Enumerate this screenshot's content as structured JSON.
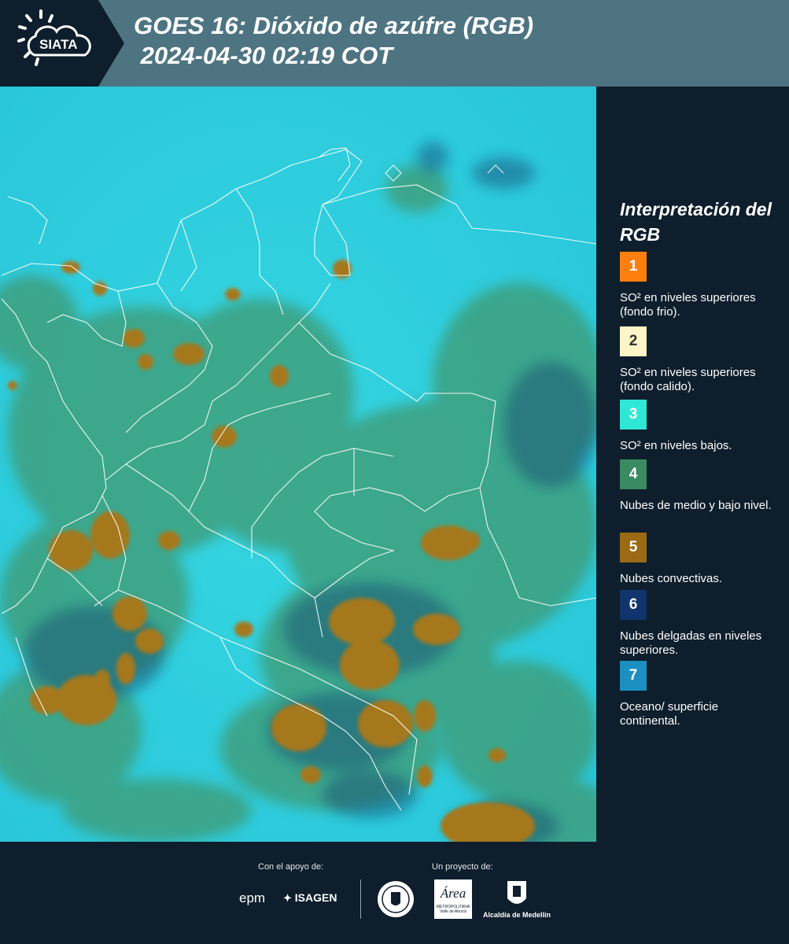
{
  "header": {
    "logo_text": "SIATA",
    "title_line1": "GOES 16: Dióxido de azúfre (RGB)",
    "title_line2": " 2024-04-30 02:19 COT"
  },
  "legend": {
    "title": "Interpretación del RGB",
    "items": [
      {
        "number": "1",
        "color": "#ff7f0e",
        "text": "SO² en niveles superiores (fondo frio)."
      },
      {
        "number": "2",
        "color": "#fdf5c6",
        "text": "SO² en niveles superiores (fondo calido)."
      },
      {
        "number": "3",
        "color": "#2ee8d5",
        "text": "SO² en niveles bajos."
      },
      {
        "number": "4",
        "color": "#3a8a62",
        "text": "Nubes de medio y bajo nivel."
      },
      {
        "number": "5",
        "color": "#9b6a14",
        "text": "Nubes convectivas."
      },
      {
        "number": "6",
        "color": "#10346b",
        "text": "Nubes delgadas en niveles superiores."
      },
      {
        "number": "7",
        "color": "#1a8fc0",
        "text": "Oceano/ superficie continental."
      }
    ]
  },
  "footer": {
    "support_label": "Con el apoyo de:",
    "project_label": "Un proyecto de:",
    "sponsor_epm": "epm",
    "sponsor_isagen": "ISAGEN",
    "area_logo_text": "Área",
    "area_subtitle": "METROPOLITANA",
    "area_subtitle2": "Valle de Aburrá",
    "alcaldia_text": "Alcaldía de Medellín"
  }
}
